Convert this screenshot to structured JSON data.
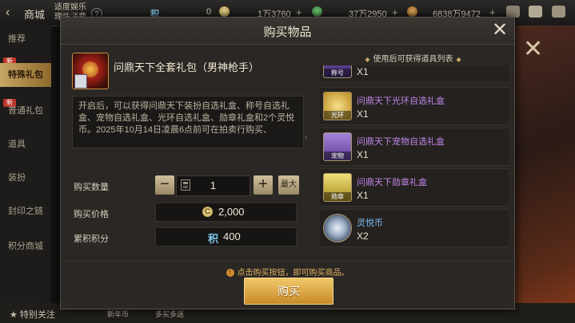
{
  "topbar": {
    "title": "商城",
    "notice": "适度娱乐 理性消费",
    "help": "?",
    "points_symbol": "积",
    "points_value": "0",
    "gold_value": "1万3760",
    "coin_value": "37万2950",
    "cash_value": "6838万9472"
  },
  "leftnav": {
    "new_tag": "新",
    "items": [
      "推荐",
      "特殊礼包",
      "普通礼包",
      "道具",
      "装扮",
      "封印之链",
      "积分商城"
    ]
  },
  "bottom": {
    "follow": "特别关注",
    "t1": "新年币",
    "t2": "多买多送"
  },
  "modal": {
    "title": "购买物品",
    "close": "✕",
    "item_name": "问鼎天下全套礼包（男神枪手）",
    "description": "开启后，可以获得问鼎天下装扮自选礼盒、称号自选礼盒、宠物自选礼盒、光环自选礼盒、勋章礼盒和2个灵悦币。2025年10月14日凌晨6点前可在拍卖行购买、",
    "quantity_label": "购买数量",
    "quantity_value": "1",
    "max_label": "最大",
    "price_label": "购买价格",
    "price_value": "2,000",
    "price_symbol": "C",
    "points_label": "累积积分",
    "points_symbol": "积",
    "points_value": "400",
    "list_title": "使用后可获得道具列表",
    "list": [
      {
        "name": "",
        "qty": "X1",
        "tag": "称号"
      },
      {
        "name": "问鼎天下光环自选礼盒",
        "qty": "X1",
        "tag": "光环"
      },
      {
        "name": "问鼎天下宠物自选礼盒",
        "qty": "X1",
        "tag": "宠物"
      },
      {
        "name": "问鼎天下勋章礼盒",
        "qty": "X1",
        "tag": "勋章"
      },
      {
        "name": "灵悦币",
        "qty": "X2",
        "tag": ""
      }
    ],
    "hint": "点击购买按钮，即可购买商品。",
    "buy_label": "购买"
  }
}
